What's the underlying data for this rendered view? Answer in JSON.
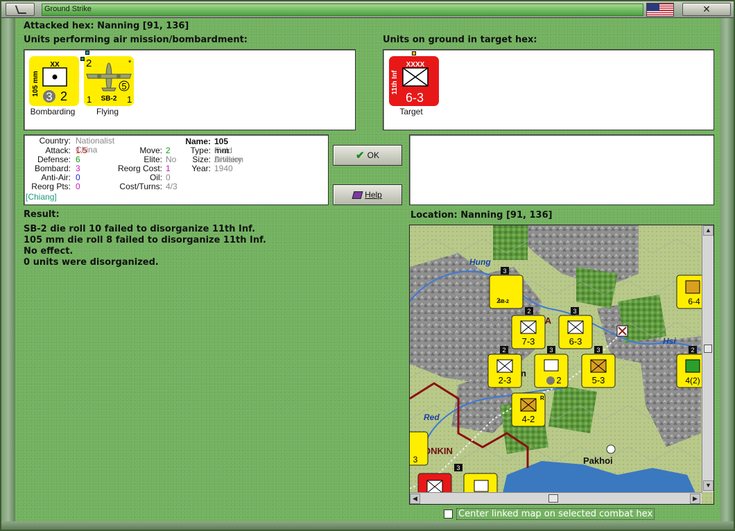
{
  "window": {
    "title": "Ground Strike",
    "close_glyph": "✕",
    "flag": "us-flag-icon"
  },
  "header": {
    "attacked_hex": "Attacked hex: Nanning  [91, 136]",
    "air_units_label": "Units performing air mission/bombardment:",
    "ground_units_label": "Units on ground in target hex:"
  },
  "attackers": [
    {
      "caption": "Bombarding",
      "side_label": "105 mm",
      "size": "XX",
      "attack": "3",
      "defense": "2",
      "color": "#ffee00"
    },
    {
      "caption": "Flying",
      "number": "2",
      "name": "SB-2",
      "range": "5",
      "left": "1",
      "right": "1",
      "star": "*",
      "color": "#ffee00"
    }
  ],
  "target": {
    "caption": "Target",
    "side_label": "11th Inf",
    "size": "XXXX",
    "strength": "6-3",
    "color": "#e81818"
  },
  "unit_info": {
    "country_k": "Country:",
    "country_v": "Nationalist China",
    "attack_k": "Attack:",
    "attack_v": "1.5",
    "defense_k": "Defense:",
    "defense_v": "6",
    "bombard_k": "Bombard:",
    "bombard_v": "3",
    "antiair_k": "Anti-Air:",
    "antiair_v": "0",
    "reorgpts_k": "Reorg Pts:",
    "reorgpts_v": "0",
    "leader": "[Chiang]",
    "move_k": "Move:",
    "move_v": "2",
    "elite_k": "Elite:",
    "elite_v": "No",
    "reorgcost_k": "Reorg Cost:",
    "reorgcost_v": "1",
    "oil_k": "Oil:",
    "oil_v": "0",
    "costturns_k": "Cost/Turns:",
    "costturns_v": "4/3",
    "name_k": "Name:",
    "name_v": "105 mm",
    "type_k": "Type:",
    "type_v": "Field Artillery",
    "sizek": "Size:",
    "size_v": "Division",
    "year_k": "Year:",
    "year_v": "1940"
  },
  "buttons": {
    "ok": "OK",
    "help": "Help"
  },
  "result": {
    "label": "Result:",
    "lines": [
      "SB-2 die roll 10 failed to disorganize 11th Inf.",
      "105 mm die roll 8 failed to disorganize 11th Inf.",
      "No effect.",
      "0 units were disorganized."
    ]
  },
  "location": {
    "label": "Location:  Nanning  [91, 136]"
  },
  "map": {
    "river_labels": [
      "Hung",
      "Hsi",
      "Red"
    ],
    "place_labels": [
      "Pakhoi",
      "ONKIN",
      "nn",
      "VA"
    ],
    "counters": [
      {
        "strength": "7-3",
        "stack": "2",
        "size": "XXXX"
      },
      {
        "strength": "6-3",
        "stack": "3",
        "size": "XXXX"
      },
      {
        "strength": "2-3",
        "stack": "2",
        "size": "XX"
      },
      {
        "strength": "2",
        "stack": "3",
        "size": "XX"
      },
      {
        "strength": "5-3",
        "stack": "3",
        "size": "XXXX"
      },
      {
        "strength": "4-2",
        "stack": "",
        "size": "XXXX"
      },
      {
        "strength": "6-4",
        "stack": "",
        "size": "XXX"
      },
      {
        "strength": "4(2)",
        "stack": "2",
        "size": "XXXXX"
      },
      {
        "strength": "3",
        "stack": "",
        "size": ""
      },
      {
        "strength": "2",
        "stack": "3",
        "size": ""
      }
    ],
    "map_flag_letter": "R"
  },
  "footer": {
    "center_map_label": "Center linked map on selected combat hex",
    "center_map_checked": false
  }
}
